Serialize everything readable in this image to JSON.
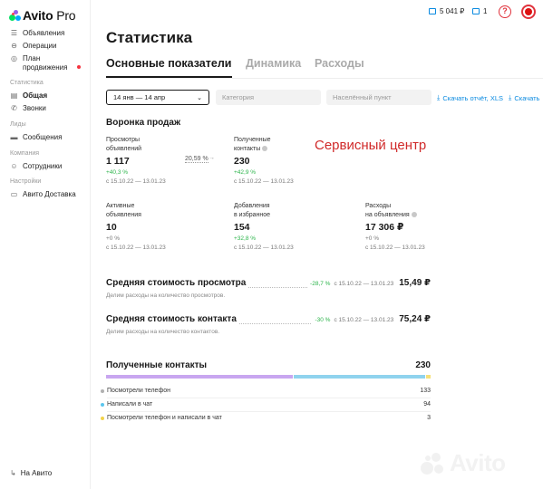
{
  "app": {
    "logo_brand": "Avito",
    "logo_suffix": "Pro"
  },
  "sidebar": {
    "items_top": [
      {
        "label": "Объявления",
        "icon": "list-icon"
      },
      {
        "label": "Операции",
        "icon": "operations-icon"
      },
      {
        "label": "План\nпродвижения",
        "icon": "promotion-icon"
      }
    ],
    "section_stats": "Статистика",
    "items_stats": [
      {
        "label": "Общая",
        "icon": "chart-icon",
        "active": true
      },
      {
        "label": "Звонки",
        "icon": "phone-icon"
      }
    ],
    "section_leads": "Лиды",
    "items_leads": [
      {
        "label": "Сообщения",
        "icon": "message-icon"
      }
    ],
    "section_company": "Компания",
    "items_company": [
      {
        "label": "Сотрудники",
        "icon": "users-icon"
      }
    ],
    "section_settings": "Настройки",
    "items_settings": [
      {
        "label": "Авито Доставка",
        "icon": "truck-icon"
      }
    ],
    "bottom_link": "На Авито"
  },
  "topbar": {
    "wallet": "5 041 ₽",
    "bonus_count": "1"
  },
  "page": {
    "title": "Статистика",
    "tabs": [
      "Основные показатели",
      "Динамика",
      "Расходы"
    ],
    "active_tab": 0
  },
  "filters": {
    "date_range": "14 янв — 14 апр",
    "category_placeholder": "Категория",
    "city_placeholder": "Населённый пункт",
    "download_xls": "Скачать отчёт, XLS",
    "download_other": "Скачать"
  },
  "funnel": {
    "title": "Воронка продаж",
    "conversion": "20,59 %",
    "overlay_text": "Сервисный центр",
    "metrics": [
      {
        "label_lines": [
          "Просмотры",
          "объявлений"
        ],
        "value": "1 117",
        "delta": "+40,3 %",
        "delta_type": "pos",
        "period": "с 15.10.22 — 13.01.23",
        "help": false
      },
      {
        "label_lines": [
          "Полученные",
          "контакты"
        ],
        "value": "230",
        "delta": "+42,9 %",
        "delta_type": "pos",
        "period": "с 15.10.22 — 13.01.23",
        "help": true
      },
      {
        "label_lines": [
          "Активные",
          "объявления"
        ],
        "value": "10",
        "delta": "+0 %",
        "delta_type": "neu",
        "period": "с 15.10.22 — 13.01.23",
        "help": false
      },
      {
        "label_lines": [
          "Добавления",
          "в избранное"
        ],
        "value": "154",
        "delta": "+32,8 %",
        "delta_type": "pos",
        "period": "с 15.10.22 — 13.01.23",
        "help": false
      },
      {
        "label_lines": [
          "Расходы",
          "на объявления"
        ],
        "value": "17 306 ₽",
        "delta": "+0 %",
        "delta_type": "neu",
        "period": "с 15.10.22 — 13.01.23",
        "help": true
      }
    ]
  },
  "costs": [
    {
      "title": "Средняя стоимость просмотра",
      "delta": "-28,7 %",
      "period": "с 15.10.22 — 13.01.23",
      "value": "15,49 ₽",
      "desc": "Делим расходы на количество просмотров."
    },
    {
      "title": "Средняя стоимость контакта",
      "delta": "-30 %",
      "period": "с 15.10.22 — 13.01.23",
      "value": "75,24 ₽",
      "desc": "Делим расходы на количество контактов."
    }
  ],
  "contacts": {
    "title": "Полученные контакты",
    "total": "230",
    "breakdown": [
      {
        "label": "Посмотрели телефон",
        "value": 133,
        "color": "#c8a6f0"
      },
      {
        "label": "Написали в чат",
        "value": 94,
        "color": "#8fd3ee"
      },
      {
        "label": "Посмотрели телефон и написали в чат",
        "value": 3,
        "color": "#f5e07a"
      }
    ]
  },
  "watermark": "Avito"
}
